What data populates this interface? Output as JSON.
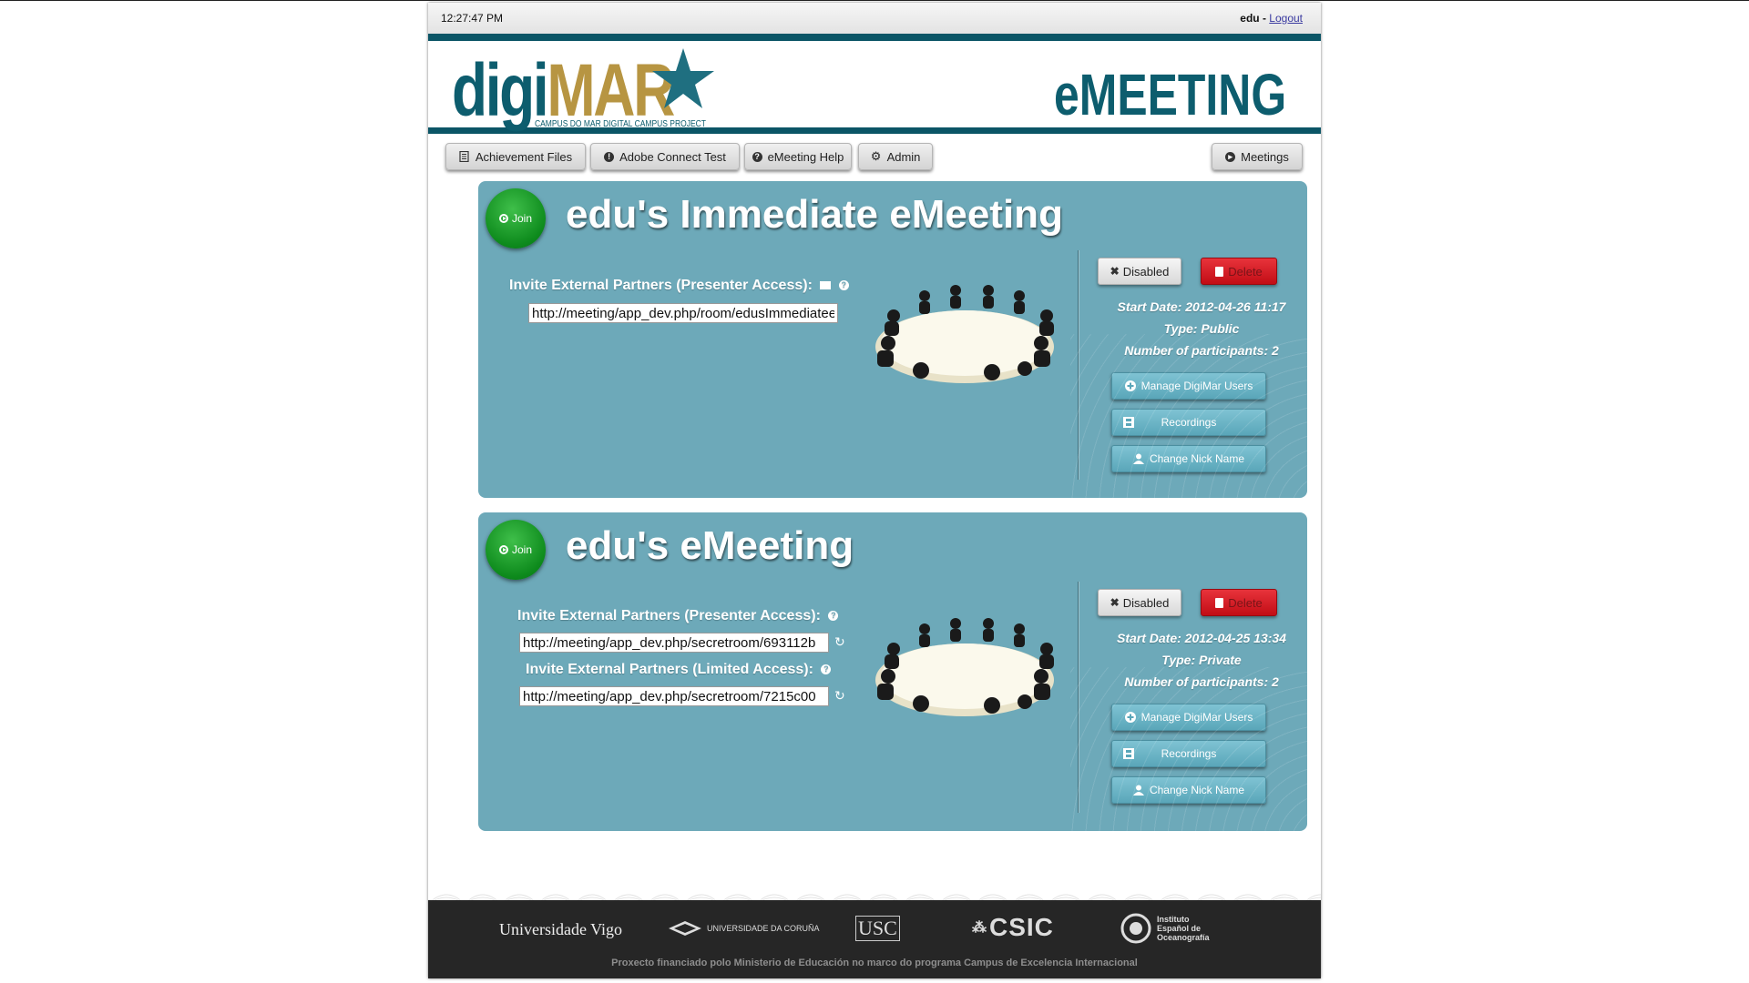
{
  "topbar": {
    "time": "12:27:47 PM",
    "username": "edu",
    "separator": " - ",
    "logout_label": "Logout"
  },
  "header": {
    "logo_digi": "digi",
    "logo_mar": "MAR",
    "logo_tagline": "CAMPUS DO MAR DIGITAL CAMPUS  PROJECT",
    "app_title": "eMEETING"
  },
  "toolbar": {
    "achievement_label": "Achievement Files",
    "adobe_label": "Adobe Connect Test",
    "help_label": "eMeeting Help",
    "admin_label": "Admin",
    "meetings_label": "Meetings"
  },
  "meetings": [
    {
      "join_label": "Join",
      "title": "edu's Immediate eMeeting",
      "presenter_label": "Invite External Partners (Presenter Access):",
      "presenter_url": "http://meeting/app_dev.php/room/edusImmediateeMeeting",
      "disabled_label": "Disabled",
      "delete_label": "Delete",
      "start_date": "Start Date: 2012-04-26 11:17",
      "type": "Type: Public",
      "participants": "Number of participants: 2",
      "manage_label": "Manage DigiMar Users",
      "recordings_label": "Recordings",
      "nickname_label": "Change Nick Name"
    },
    {
      "join_label": "Join",
      "title": "edu's eMeeting",
      "presenter_label": "Invite External Partners (Presenter Access):",
      "presenter_url": "http://meeting/app_dev.php/secretroom/693112b",
      "limited_label": "Invite External Partners (Limited Access):",
      "limited_url": "http://meeting/app_dev.php/secretroom/7215c00",
      "disabled_label": "Disabled",
      "delete_label": "Delete",
      "start_date": "Start Date: 2012-04-25 13:34",
      "type": "Type: Private",
      "participants": "Number of participants: 2",
      "manage_label": "Manage DigiMar Users",
      "recordings_label": "Recordings",
      "nickname_label": "Change Nick Name"
    }
  ],
  "footer": {
    "uvigo": "Universidade Vigo",
    "udc": "UNIVERSIDADE DA CORUÑA",
    "usc": "USC",
    "csic": "CSIC",
    "ieo": "Instituto Español de Oceanografía",
    "note": "Proxecto financiado polo Ministerio de Educación no marco do programa Campus de Excelencia Internacional"
  },
  "colors": {
    "brand_teal": "#0d5d6e",
    "brand_gold": "#b79542",
    "panel_bg": "#6da9b9",
    "join_green": "#13941f",
    "delete_red": "#d21c24",
    "footer_bg": "#262626"
  },
  "icons": {
    "achievement": "book-icon",
    "adobe": "info-circle-icon",
    "help": "question-circle-icon",
    "admin": "gear-icon",
    "meetings": "play-circle-icon",
    "join": "play-circle-icon",
    "email": "envelope-icon",
    "help_small": "question-icon",
    "refresh": "refresh-icon",
    "disabled": "x-icon",
    "delete": "trash-icon",
    "manage": "plus-circle-icon",
    "recordings": "film-icon",
    "nickname": "user-icon"
  }
}
